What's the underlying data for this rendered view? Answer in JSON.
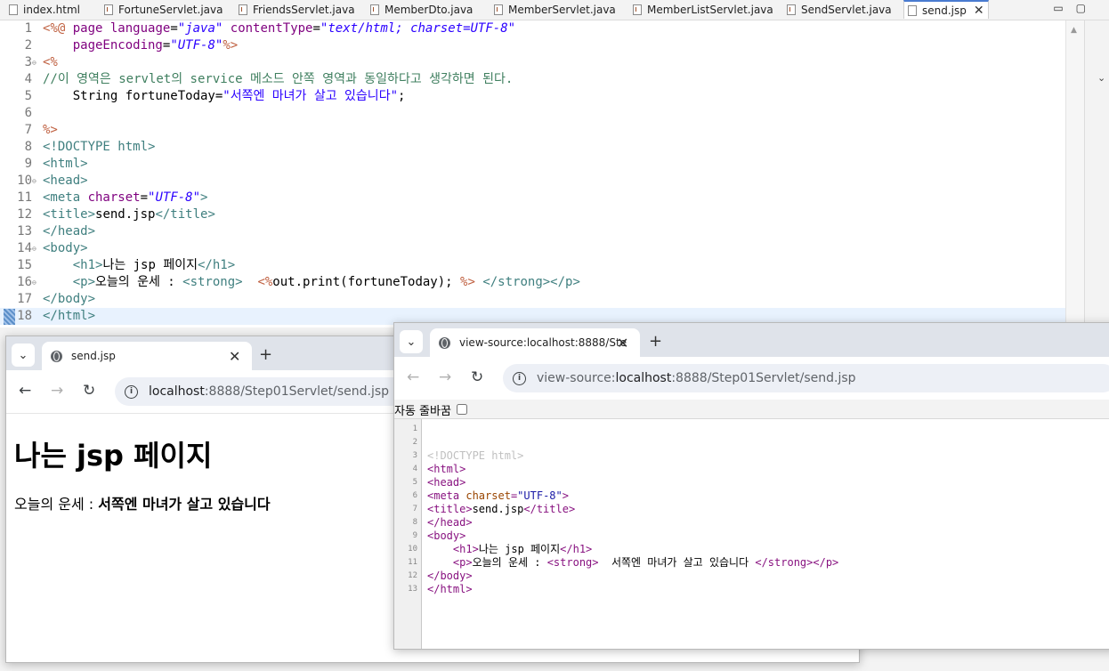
{
  "ide": {
    "tabs": [
      {
        "label": "index.html",
        "kind": "html",
        "active": false
      },
      {
        "label": "FortuneServlet.java",
        "kind": "java",
        "active": false
      },
      {
        "label": "FriendsServlet.java",
        "kind": "java",
        "active": false
      },
      {
        "label": "MemberDto.java",
        "kind": "java",
        "active": false
      },
      {
        "label": "MemberServlet.java",
        "kind": "java",
        "active": false
      },
      {
        "label": "MemberListServlet.java",
        "kind": "java",
        "active": false
      },
      {
        "label": "SendServlet.java",
        "kind": "java",
        "active": false
      },
      {
        "label": "send.jsp",
        "kind": "jsp",
        "active": true
      }
    ],
    "close_glyph": "✕",
    "minimize_glyph": "▭",
    "maximize_glyph": "▢",
    "lines": [
      {
        "n": "1",
        "fold": "",
        "segs": [
          [
            "k-jsp",
            "<%@ "
          ],
          [
            "k-attr",
            "page "
          ],
          [
            "k-attr",
            "language"
          ],
          [
            "k-plain",
            "="
          ],
          [
            "k-val",
            "\"java\""
          ],
          [
            "k-plain",
            " "
          ],
          [
            "k-attr",
            "contentType"
          ],
          [
            "k-plain",
            "="
          ],
          [
            "k-val",
            "\"text/html; charset=UTF-8\""
          ]
        ]
      },
      {
        "n": "2",
        "fold": "",
        "segs": [
          [
            "k-plain",
            "    "
          ],
          [
            "k-attr",
            "pageEncoding"
          ],
          [
            "k-plain",
            "="
          ],
          [
            "k-val",
            "\"UTF-8\""
          ],
          [
            "k-jsp",
            "%>"
          ]
        ]
      },
      {
        "n": "3",
        "fold": "⊖",
        "segs": [
          [
            "k-jsp",
            "<%"
          ]
        ]
      },
      {
        "n": "4",
        "fold": "",
        "segs": [
          [
            "k-cmt",
            "//이 영역은 servlet의 service 메소드 안쪽 영역과 동일하다고 생각하면 된다."
          ]
        ]
      },
      {
        "n": "5",
        "fold": "",
        "segs": [
          [
            "k-plain",
            "    String fortuneToday="
          ],
          [
            "k-str",
            "\"서쪽엔 마녀가 살고 있습니다\""
          ],
          [
            "k-plain",
            ";"
          ]
        ]
      },
      {
        "n": "6",
        "fold": "",
        "segs": [
          [
            "k-plain",
            ""
          ]
        ]
      },
      {
        "n": "7",
        "fold": "",
        "segs": [
          [
            "k-jsp",
            "%>"
          ]
        ]
      },
      {
        "n": "8",
        "fold": "",
        "segs": [
          [
            "k-tag",
            "<!DOCTYPE html>"
          ]
        ]
      },
      {
        "n": "9",
        "fold": "",
        "segs": [
          [
            "k-tag",
            "<html>"
          ]
        ]
      },
      {
        "n": "10",
        "fold": "⊖",
        "segs": [
          [
            "k-tag",
            "<head>"
          ]
        ]
      },
      {
        "n": "11",
        "fold": "",
        "segs": [
          [
            "k-tag",
            "<meta "
          ],
          [
            "k-attr",
            "charset"
          ],
          [
            "k-plain",
            "="
          ],
          [
            "k-val",
            "\"UTF-8\""
          ],
          [
            "k-tag",
            ">"
          ]
        ]
      },
      {
        "n": "12",
        "fold": "",
        "segs": [
          [
            "k-tag",
            "<title>"
          ],
          [
            "k-plain",
            "send.jsp"
          ],
          [
            "k-tag",
            "</title>"
          ]
        ]
      },
      {
        "n": "13",
        "fold": "",
        "segs": [
          [
            "k-tag",
            "</head>"
          ]
        ]
      },
      {
        "n": "14",
        "fold": "⊖",
        "segs": [
          [
            "k-tag",
            "<body>"
          ]
        ]
      },
      {
        "n": "15",
        "fold": "",
        "segs": [
          [
            "k-plain",
            "    "
          ],
          [
            "k-tag",
            "<h1>"
          ],
          [
            "k-plain",
            "나는 jsp 페이지"
          ],
          [
            "k-tag",
            "</h1>"
          ]
        ]
      },
      {
        "n": "16",
        "fold": "⊖",
        "segs": [
          [
            "k-plain",
            "    "
          ],
          [
            "k-tag",
            "<p>"
          ],
          [
            "k-plain",
            "오늘의 운세 : "
          ],
          [
            "k-tag",
            "<strong>"
          ],
          [
            "k-plain",
            "  "
          ],
          [
            "k-jsp",
            "<%"
          ],
          [
            "k-plain",
            "out.print(fortuneToday); "
          ],
          [
            "k-jsp",
            "%>"
          ],
          [
            "k-plain",
            " "
          ],
          [
            "k-tag",
            "</strong></p>"
          ]
        ]
      },
      {
        "n": "17",
        "fold": "",
        "segs": [
          [
            "k-tag",
            "</body>"
          ]
        ]
      },
      {
        "n": "18",
        "fold": "",
        "segs": [
          [
            "k-tag",
            "</html>"
          ]
        ]
      }
    ]
  },
  "browser1": {
    "tab_title": "send.jsp",
    "url_host": "localhost",
    "url_rest": ":8888/Step01Servlet/send.jsp",
    "heading": "나는 jsp 페이지",
    "fortune_label": "오늘의 운세 : ",
    "fortune_value": "서쪽엔 마녀가 살고 있습니다"
  },
  "browser2": {
    "tab_title": "view-source:localhost:8888/Ste",
    "url_prefix": "view-source:",
    "url_host": "localhost",
    "url_rest": ":8888/Step01Servlet/send.jsp",
    "wrap_label": "자동 줄바꿈",
    "source_lines": [
      {
        "n": "1",
        "segs": []
      },
      {
        "n": "2",
        "segs": []
      },
      {
        "n": "3",
        "segs": [
          [
            "s-doc",
            "<!DOCTYPE html>"
          ]
        ]
      },
      {
        "n": "4",
        "segs": [
          [
            "s-tag",
            "<html>"
          ]
        ]
      },
      {
        "n": "5",
        "segs": [
          [
            "s-tag",
            "<head>"
          ]
        ]
      },
      {
        "n": "6",
        "segs": [
          [
            "s-tag",
            "<meta "
          ],
          [
            "s-attr",
            "charset"
          ],
          [
            "s-tag",
            "="
          ],
          [
            "s-val",
            "\"UTF-8\""
          ],
          [
            "s-tag",
            ">"
          ]
        ]
      },
      {
        "n": "7",
        "segs": [
          [
            "s-tag",
            "<title>"
          ],
          [
            "s-txt",
            "send.jsp"
          ],
          [
            "s-tag",
            "</title>"
          ]
        ]
      },
      {
        "n": "8",
        "segs": [
          [
            "s-tag",
            "</head>"
          ]
        ]
      },
      {
        "n": "9",
        "segs": [
          [
            "s-tag",
            "<body>"
          ]
        ]
      },
      {
        "n": "10",
        "segs": [
          [
            "s-txt",
            "    "
          ],
          [
            "s-tag",
            "<h1>"
          ],
          [
            "s-txt",
            "나는 jsp 페이지"
          ],
          [
            "s-tag",
            "</h1>"
          ]
        ]
      },
      {
        "n": "11",
        "segs": [
          [
            "s-txt",
            "    "
          ],
          [
            "s-tag",
            "<p>"
          ],
          [
            "s-txt",
            "오늘의 운세 : "
          ],
          [
            "s-tag",
            "<strong>"
          ],
          [
            "s-txt",
            "  서쪽엔 마녀가 살고 있습니다 "
          ],
          [
            "s-tag",
            "</strong></p>"
          ]
        ]
      },
      {
        "n": "12",
        "segs": [
          [
            "s-tag",
            "</body>"
          ]
        ]
      },
      {
        "n": "13",
        "segs": [
          [
            "s-tag",
            "</html>"
          ]
        ]
      }
    ]
  },
  "icons": {
    "tab_search": "chevron-down-icon",
    "back": "back-arrow-icon",
    "forward": "forward-arrow-icon",
    "reload": "reload-icon",
    "info": "info-icon",
    "globe": "globe-icon",
    "new_tab": "plus-icon"
  },
  "glyphs": {
    "tab_search": "⌄",
    "back": "←",
    "forward": "→",
    "reload": "↻",
    "info": "i",
    "new_tab": "+",
    "close": "✕",
    "scroll_up": "▲",
    "outline_chevron": "⌄"
  }
}
